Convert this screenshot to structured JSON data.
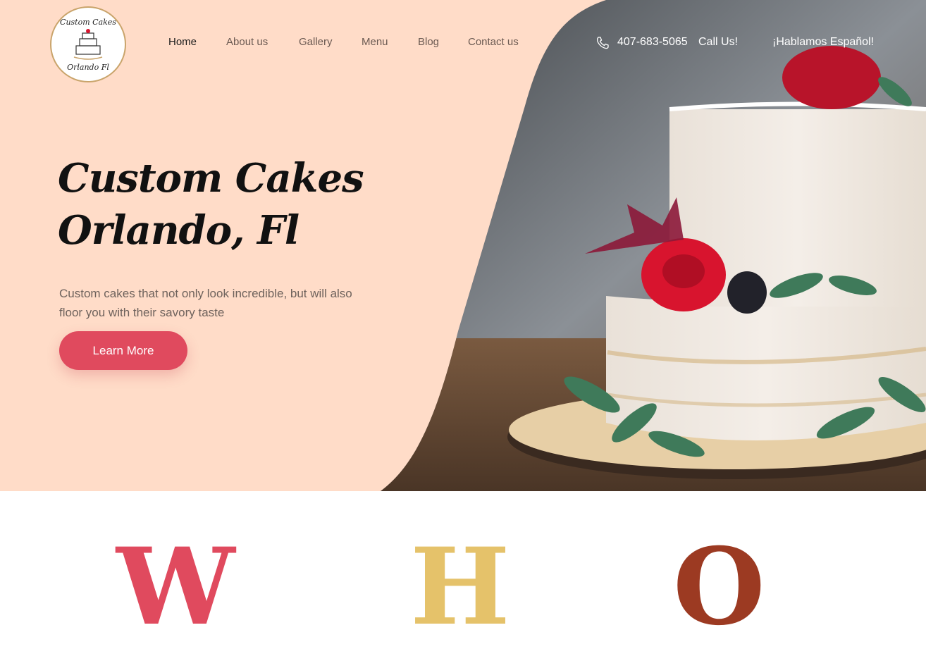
{
  "brand": {
    "logo_top": "Custom Cakes",
    "logo_bottom": "Orlando Fl",
    "colors": {
      "hero_bg": "#ffdcc8",
      "accent": "#e04a5e",
      "gold": "#e5c26a",
      "rust": "#9c3a22"
    }
  },
  "nav": {
    "items": [
      {
        "label": "Home",
        "active": true
      },
      {
        "label": "About us",
        "active": false
      },
      {
        "label": "Gallery",
        "active": false
      },
      {
        "label": "Menu",
        "active": false
      },
      {
        "label": "Blog",
        "active": false
      },
      {
        "label": "Contact us",
        "active": false
      }
    ]
  },
  "contact": {
    "phone_icon": "phone-icon",
    "phone": "407-683-5065",
    "call_label": "Call Us!",
    "spanish": "¡Hablamos Español!"
  },
  "hero": {
    "title_line1": "Custom Cakes",
    "title_line2": "Orlando, Fl",
    "subtitle": "Custom cakes that not only look incredible, but will also floor you with their savory taste",
    "cta_label": "Learn More"
  },
  "section_letters": [
    "W",
    "H",
    "O"
  ]
}
